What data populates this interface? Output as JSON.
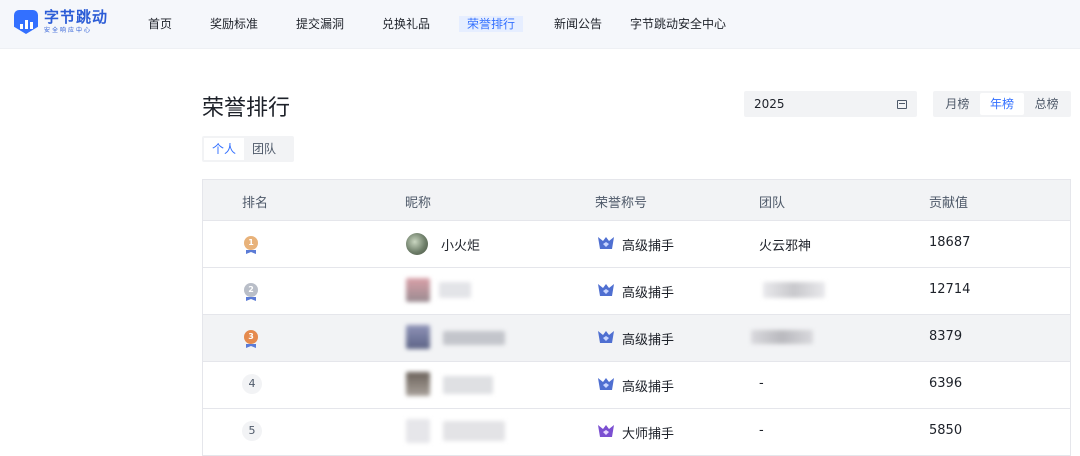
{
  "header": {
    "logo_title": "字节跳动",
    "logo_sub": "安全响应中心",
    "brand_color": "#3370ff",
    "nav": [
      {
        "label": "首页"
      },
      {
        "label": "奖励标准"
      },
      {
        "label": "提交漏洞"
      },
      {
        "label": "兑换礼品"
      },
      {
        "label": "荣誉排行"
      },
      {
        "label": "新闻公告"
      },
      {
        "label": "字节跳动安全中心"
      }
    ],
    "active_nav": "荣誉排行"
  },
  "page": {
    "title": "荣誉排行",
    "year_value": "2025",
    "period_tabs": [
      {
        "label": "月榜"
      },
      {
        "label": "年榜"
      },
      {
        "label": "总榜"
      }
    ],
    "active_period": "年榜",
    "type_tabs": [
      {
        "label": "个人"
      },
      {
        "label": "团队"
      }
    ],
    "active_type": "个人"
  },
  "table": {
    "headers": [
      "排名",
      "昵称",
      "荣誉称号",
      "团队",
      "贡献值"
    ],
    "rows": [
      {
        "rank": "1",
        "nickname": "小火炬",
        "title": "高级捕手",
        "team": "火云邪神",
        "score": "18687",
        "medal_color": "#e8b27a"
      },
      {
        "rank": "2",
        "nickname": "",
        "title": "高级捕手",
        "team": "",
        "score": "12714",
        "medal_color": "#b9bec8"
      },
      {
        "rank": "3",
        "nickname": "",
        "title": "高级捕手",
        "team": "",
        "score": "8379",
        "medal_color": "#e58a4e"
      },
      {
        "rank": "4",
        "nickname": "",
        "title": "高级捕手",
        "team": "-",
        "score": "6396"
      },
      {
        "rank": "5",
        "nickname": "",
        "title": "大师捕手",
        "team": "-",
        "score": "5850"
      }
    ]
  }
}
